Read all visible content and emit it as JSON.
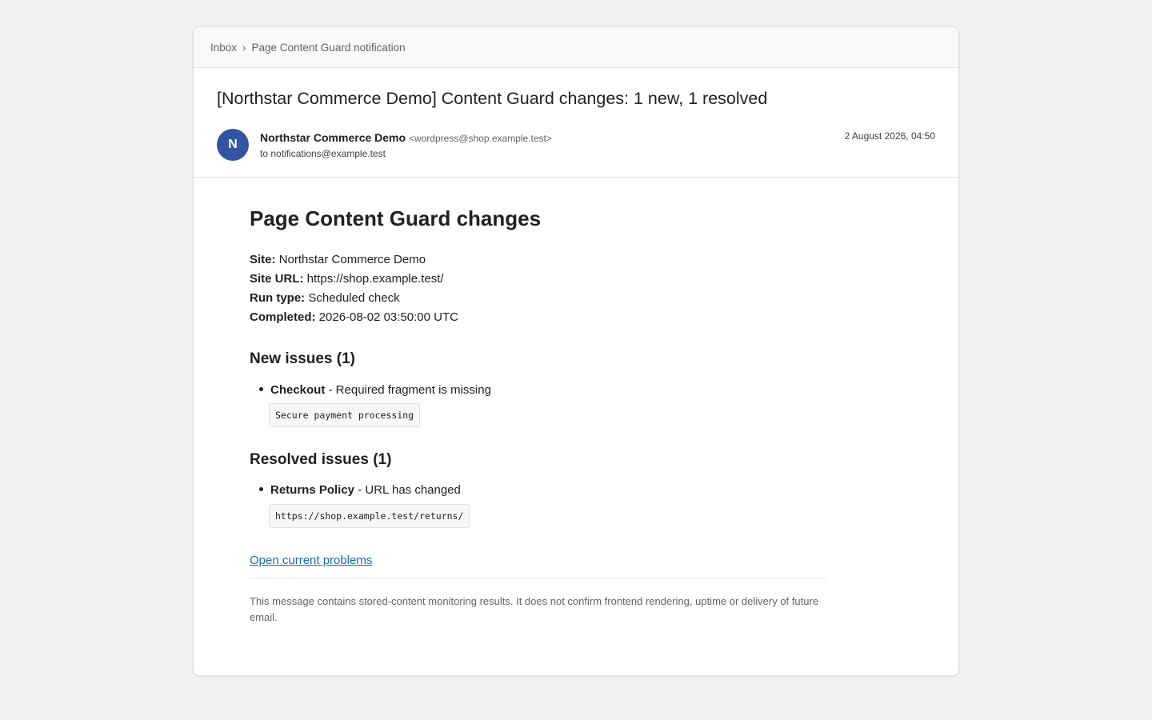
{
  "breadcrumb": {
    "inbox": "Inbox",
    "separator": "›",
    "current": "Page Content Guard notification"
  },
  "email": {
    "subject": "[Northstar Commerce Demo] Content Guard changes: 1 new, 1 resolved",
    "avatar_initial": "N",
    "avatar_color": "#3354a3",
    "sender_name": "Northstar Commerce Demo",
    "sender_address": "<wordpress@shop.example.test>",
    "recipient": "to notifications@example.test",
    "date": "2 August 2026, 04:50"
  },
  "content": {
    "title": "Page Content Guard changes",
    "meta": [
      {
        "key": "Site:",
        "value": "Northstar Commerce Demo"
      },
      {
        "key": "Site URL:",
        "value": "https://shop.example.test/"
      },
      {
        "key": "Run type:",
        "value": "Scheduled check"
      },
      {
        "key": "Completed:",
        "value": "2026-08-02 03:50:00 UTC"
      }
    ],
    "new_issues": {
      "title": "New issues (1)",
      "items": [
        {
          "page": "Checkout",
          "description": " - Required fragment is missing",
          "code": "Secure payment processing"
        }
      ]
    },
    "resolved_issues": {
      "title": "Resolved issues (1)",
      "items": [
        {
          "page": "Returns Policy",
          "description": " - URL has changed",
          "code": "https://shop.example.test/returns/"
        }
      ]
    },
    "link_label": "Open current problems",
    "link_color": "#1a6bb0",
    "footer": "This message contains stored-content monitoring results. It does not confirm frontend rendering, uptime or delivery of future email."
  }
}
